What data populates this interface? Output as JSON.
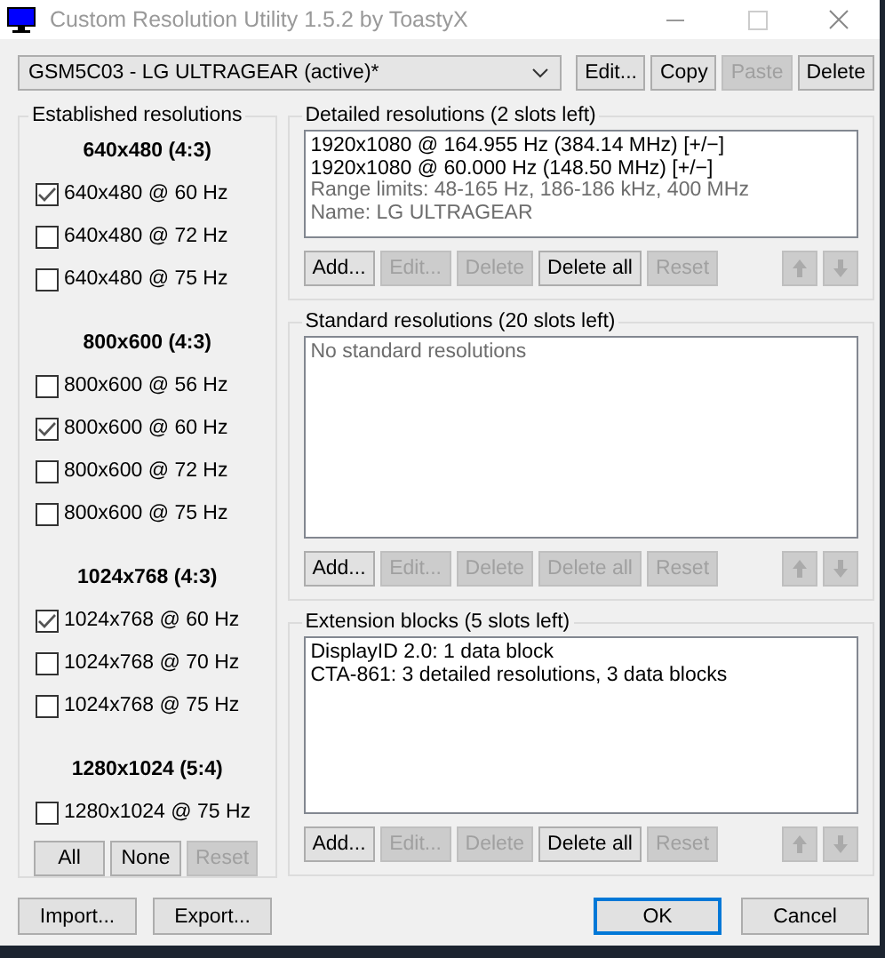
{
  "window": {
    "title": "Custom Resolution Utility 1.5.2 by ToastyX",
    "active": false
  },
  "monitor_select": {
    "value": "GSM5C03 - LG ULTRAGEAR (active)*"
  },
  "monitor_buttons": [
    {
      "label": "Edit...",
      "disabled": false
    },
    {
      "label": "Copy",
      "disabled": false
    },
    {
      "label": "Paste",
      "disabled": true
    },
    {
      "label": "Delete",
      "disabled": false
    }
  ],
  "established": {
    "title": "Established resolutions",
    "groups": [
      {
        "heading": "640x480 (4:3)",
        "items": [
          {
            "label": "640x480 @ 60 Hz",
            "checked": true
          },
          {
            "label": "640x480 @ 72 Hz",
            "checked": false
          },
          {
            "label": "640x480 @ 75 Hz",
            "checked": false
          }
        ]
      },
      {
        "heading": "800x600 (4:3)",
        "items": [
          {
            "label": "800x600 @ 56 Hz",
            "checked": false
          },
          {
            "label": "800x600 @ 60 Hz",
            "checked": true
          },
          {
            "label": "800x600 @ 72 Hz",
            "checked": false
          },
          {
            "label": "800x600 @ 75 Hz",
            "checked": false
          }
        ]
      },
      {
        "heading": "1024x768 (4:3)",
        "items": [
          {
            "label": "1024x768 @ 60 Hz",
            "checked": true
          },
          {
            "label": "1024x768 @ 70 Hz",
            "checked": false
          },
          {
            "label": "1024x768 @ 75 Hz",
            "checked": false
          }
        ]
      },
      {
        "heading": "1280x1024 (5:4)",
        "items": [
          {
            "label": "1280x1024 @ 75 Hz",
            "checked": false
          }
        ]
      }
    ],
    "buttons": [
      {
        "label": "All",
        "disabled": false
      },
      {
        "label": "None",
        "disabled": false
      },
      {
        "label": "Reset",
        "disabled": true
      }
    ]
  },
  "sections": [
    {
      "title": "Detailed resolutions (2 slots left)",
      "lines": [
        {
          "text": "1920x1080 @ 164.955 Hz (384.14 MHz) [+/−]",
          "kind": "entry"
        },
        {
          "text": "1920x1080 @ 60.000 Hz (148.50 MHz) [+/−]",
          "kind": "entry"
        },
        {
          "text": "Range limits: 48-165 Hz, 186-186 kHz, 400 MHz",
          "kind": "info"
        },
        {
          "text": "Name: LG ULTRAGEAR",
          "kind": "info"
        }
      ],
      "buttons": [
        {
          "label": "Add...",
          "disabled": false
        },
        {
          "label": "Edit...",
          "disabled": true
        },
        {
          "label": "Delete",
          "disabled": true
        },
        {
          "label": "Delete all",
          "disabled": false
        },
        {
          "label": "Reset",
          "disabled": true
        }
      ],
      "arrows": [
        {
          "kind": "up",
          "disabled": true
        },
        {
          "kind": "down",
          "disabled": true
        }
      ]
    },
    {
      "title": "Standard resolutions (20 slots left)",
      "lines": [
        {
          "text": "No standard resolutions",
          "kind": "info"
        }
      ],
      "buttons": [
        {
          "label": "Add...",
          "disabled": false
        },
        {
          "label": "Edit...",
          "disabled": true
        },
        {
          "label": "Delete",
          "disabled": true
        },
        {
          "label": "Delete all",
          "disabled": true
        },
        {
          "label": "Reset",
          "disabled": true
        }
      ],
      "arrows": [
        {
          "kind": "up",
          "disabled": true
        },
        {
          "kind": "down",
          "disabled": true
        }
      ]
    },
    {
      "title": "Extension blocks (5 slots left)",
      "lines": [
        {
          "text": "DisplayID 2.0: 1 data block",
          "kind": "entry"
        },
        {
          "text": "CTA-861: 3 detailed resolutions, 3 data blocks",
          "kind": "entry"
        }
      ],
      "buttons": [
        {
          "label": "Add...",
          "disabled": false
        },
        {
          "label": "Edit...",
          "disabled": true
        },
        {
          "label": "Delete",
          "disabled": true
        },
        {
          "label": "Delete all",
          "disabled": false
        },
        {
          "label": "Reset",
          "disabled": true
        }
      ],
      "arrows": [
        {
          "kind": "up",
          "disabled": true
        },
        {
          "kind": "down",
          "disabled": true
        }
      ]
    }
  ],
  "footer_left": [
    {
      "label": "Import...",
      "disabled": false
    },
    {
      "label": "Export...",
      "disabled": false
    }
  ],
  "footer_right": [
    {
      "label": "OK",
      "default": true
    },
    {
      "label": "Cancel",
      "default": false
    }
  ]
}
